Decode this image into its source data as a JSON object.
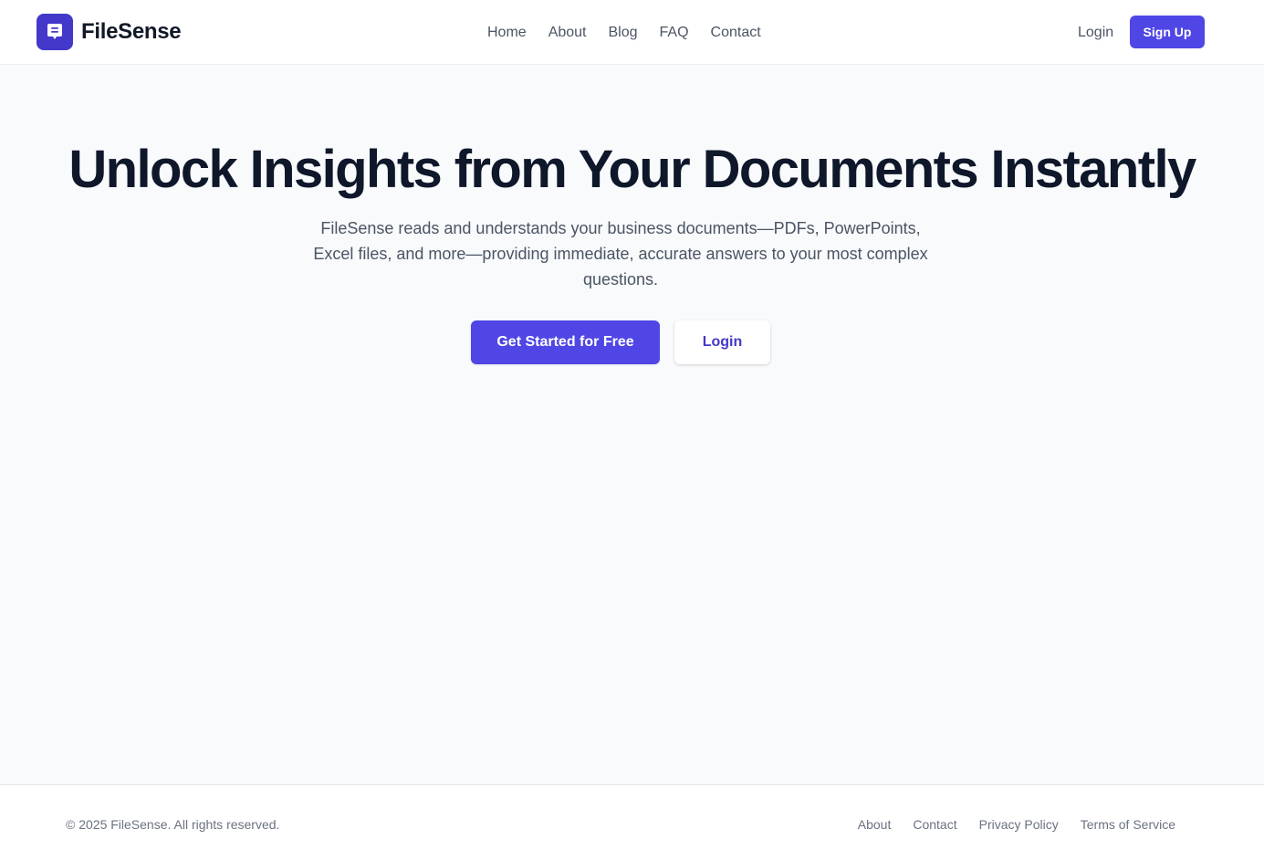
{
  "brand": {
    "name": "FileSense",
    "accent_color": "#4f46e5",
    "logo_icon": "chat-bubble-icon"
  },
  "nav": {
    "items": [
      {
        "label": "Home"
      },
      {
        "label": "About"
      },
      {
        "label": "Blog"
      },
      {
        "label": "FAQ"
      },
      {
        "label": "Contact"
      }
    ],
    "login_label": "Login",
    "signup_label": "Sign Up"
  },
  "hero": {
    "title": "Unlock Insights from Your Documents Instantly",
    "subtitle": "FileSense reads and understands your business documents—PDFs, PowerPoints, Excel files, and more—providing immediate, accurate answers to your most complex questions.",
    "primary_cta": "Get Started for Free",
    "secondary_cta": "Login"
  },
  "footer": {
    "copyright": "© 2025 FileSense. All rights reserved.",
    "links": [
      {
        "label": "About"
      },
      {
        "label": "Contact"
      },
      {
        "label": "Privacy Policy"
      },
      {
        "label": "Terms of Service"
      }
    ]
  }
}
